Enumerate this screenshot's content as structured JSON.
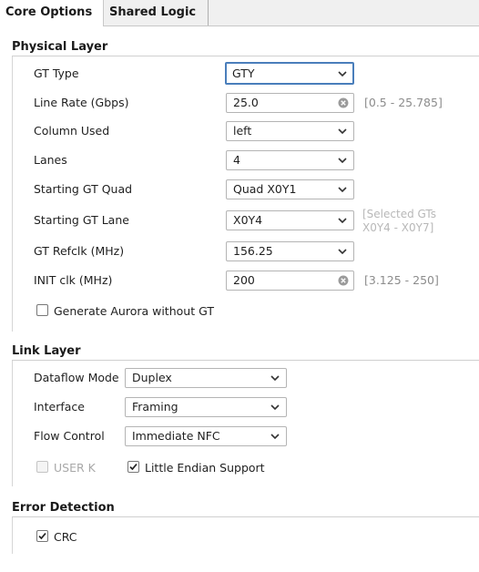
{
  "tabs": [
    {
      "label": "Core Options"
    },
    {
      "label": "Shared Logic"
    }
  ],
  "physical": {
    "title": "Physical Layer",
    "gt_type": {
      "label": "GT Type",
      "value": "GTY"
    },
    "line_rate": {
      "label": "Line Rate (Gbps)",
      "value": "25.0",
      "range": "[0.5 - 25.785]"
    },
    "column_used": {
      "label": "Column Used",
      "value": "left"
    },
    "lanes": {
      "label": "Lanes",
      "value": "4"
    },
    "starting_quad": {
      "label": "Starting GT Quad",
      "value": "Quad X0Y1"
    },
    "starting_lane": {
      "label": "Starting GT Lane",
      "value": "X0Y4",
      "hint_line1": "[Selected GTs",
      "hint_line2": "X0Y4 - X0Y7]"
    },
    "refclk": {
      "label": "GT Refclk (MHz)",
      "value": "156.25"
    },
    "init_clk": {
      "label": "INIT clk (MHz)",
      "value": "200",
      "range": "[3.125 - 250]"
    },
    "without_gt": {
      "label": "Generate Aurora without GT",
      "checked": false
    }
  },
  "link": {
    "title": "Link Layer",
    "dataflow": {
      "label": "Dataflow Mode",
      "value": "Duplex"
    },
    "interface": {
      "label": "Interface",
      "value": "Framing"
    },
    "flow_control": {
      "label": "Flow Control",
      "value": "Immediate NFC"
    },
    "user_k": {
      "label": "USER K",
      "checked": false,
      "enabled": false
    },
    "little_endian": {
      "label": "Little Endian Support",
      "checked": true
    }
  },
  "error": {
    "title": "Error Detection",
    "crc": {
      "label": "CRC",
      "checked": true
    }
  },
  "colors": {
    "focus": "#4a7ebb",
    "disabled_text": "#a8a8a8",
    "hint_text": "#8c8c8c"
  }
}
